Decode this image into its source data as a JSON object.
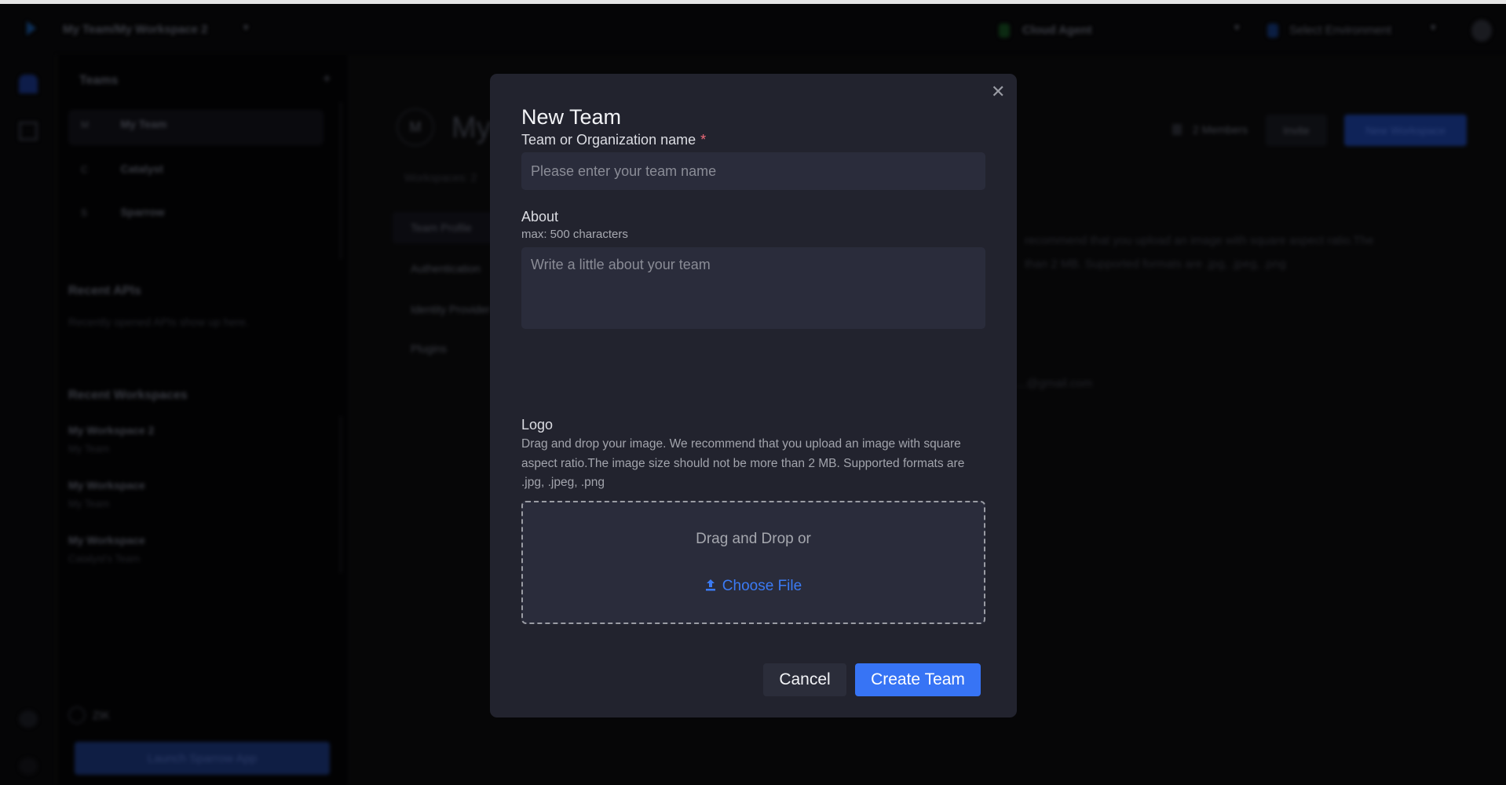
{
  "background": {
    "header": {
      "breadcrumb": "My Team/My Workspace 2",
      "agent": "Cloud Agent",
      "environment": "Select Environment"
    },
    "sidebar": {
      "teams_title": "Teams",
      "teams": [
        {
          "label": "My Team",
          "initial": "M"
        },
        {
          "label": "Catalyst",
          "initial": "C"
        },
        {
          "label": "Sparrow",
          "initial": "S"
        }
      ],
      "recent_apis_title": "Recent APIs",
      "recent_apis_empty": "Recently opened APIs show up here.",
      "recent_workspaces_title": "Recent Workspaces",
      "recent_workspaces": [
        {
          "name": "My Workspace 2",
          "team": "My Team"
        },
        {
          "name": "My Workspace",
          "team": "My Team"
        },
        {
          "name": "My Workspace",
          "team": "Catalyst's Team"
        }
      ],
      "user": "ZIK",
      "launch_button": "Launch Sparrow App"
    },
    "main": {
      "avatar_initial": "M",
      "team_title": "My Team",
      "workspaces_label": "Workspaces: 2",
      "tabs": [
        "Team Profile",
        "Authentication",
        "Identity Provider",
        "Plugins"
      ],
      "members": "2 Members",
      "invite": "Invite",
      "new_workspace": "New Workspace",
      "logo_hint_1": "recommend that you upload an image with square aspect ratio.The",
      "logo_hint_2": "than 2 MB. Supported formats are .jpg, .jpeg, .png",
      "email": "...@gmail.com"
    }
  },
  "modal": {
    "title": "New Team",
    "close_icon": "close-icon",
    "name_label": "Team or Organization name",
    "required_mark": "*",
    "name_placeholder": "Please enter your team name",
    "name_value": "",
    "about_label": "About",
    "about_hint": "max: 500 characters",
    "about_placeholder": "Write a little about your team",
    "about_value": "",
    "logo_label": "Logo",
    "logo_description": "Drag and drop your image. We recommend that you upload an image with square aspect ratio.The image size should not be more than 2 MB. Supported formats are .jpg, .jpeg, .png",
    "drop_text": "Drag and Drop or",
    "choose_file": "Choose File",
    "upload_icon": "upload-icon",
    "cancel": "Cancel",
    "create": "Create Team",
    "colors": {
      "primary": "#3774f5",
      "required": "#f06b7a",
      "modal_bg": "#22232e",
      "input_bg": "#2a2c3b"
    }
  }
}
